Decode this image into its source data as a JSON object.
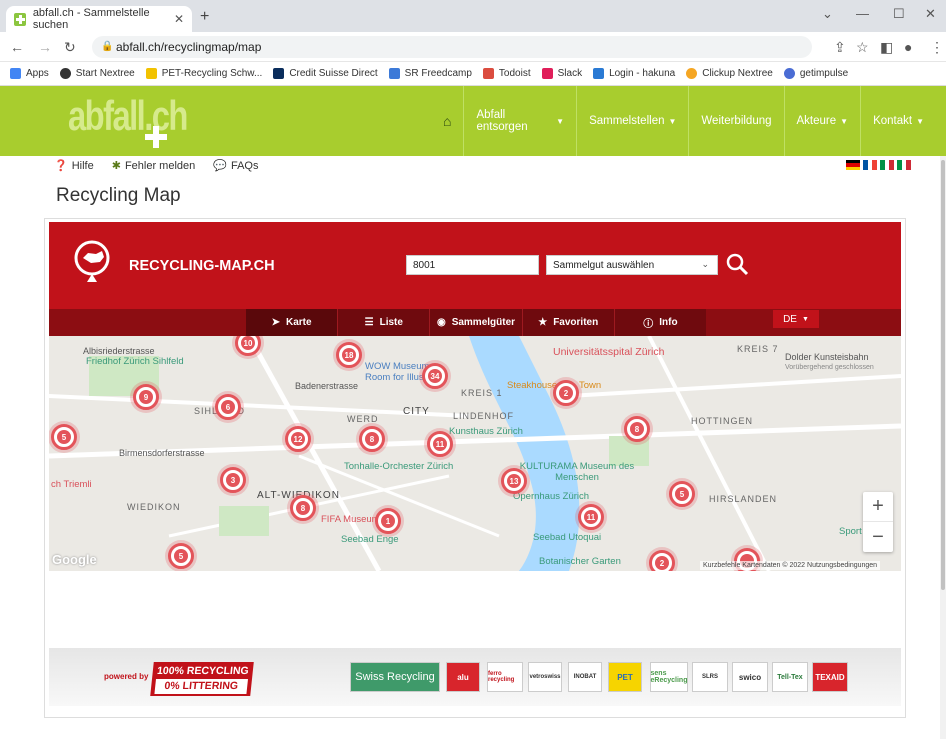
{
  "browser": {
    "tab_title": "abfall.ch - Sammelstelle suchen",
    "url": "abfall.ch/recyclingmap/map",
    "bookmarks": [
      "Apps",
      "Start Nextree",
      "PET-Recycling Schw...",
      "Credit Suisse Direct",
      "SR Freedcamp",
      "Todoist",
      "Slack",
      "Login - hakuna",
      "Clickup Nextree",
      "getimpulse"
    ]
  },
  "site": {
    "logo_text": "abfall.ch",
    "nav": [
      {
        "label": "Abfall entsorgen",
        "caret": true
      },
      {
        "label": "Sammelstellen",
        "caret": true
      },
      {
        "label": "Weiterbildung",
        "caret": false
      },
      {
        "label": "Akteure",
        "caret": true
      },
      {
        "label": "Kontakt",
        "caret": true
      }
    ],
    "sublinks": [
      "Hilfe",
      "Fehler melden",
      "FAQs"
    ],
    "page_title": "Recycling Map"
  },
  "recyclingmap": {
    "title": "RECYCLING-MAP.CH",
    "zip_value": "8001",
    "category_placeholder": "Sammelgut auswählen",
    "tabs": [
      "Karte",
      "Liste",
      "Sammelgüter",
      "Favoriten",
      "Info"
    ],
    "language": "DE"
  },
  "map": {
    "labels": [
      "Albisriederstrasse",
      "Friedhof Zürich Sihlfeld",
      "Badenerstrasse",
      "SIHLFELD",
      "Birmensdorferstrasse",
      "ch Triemli",
      "WIEDIKON",
      "ALT-WIEDIKON",
      "WERD",
      "CITY",
      "LINDENHOF",
      "KREIS 1",
      "HOTTINGEN",
      "HIRSLANDEN",
      "KREIS 7",
      "Universitätsspital Zürich",
      "WOW Museum Room for Illusions",
      "Steakhouse",
      "Town",
      "Kunsthaus Zürich",
      "KULTURAMA Museum des Menschen",
      "Tonhalle-Orchester Zürich",
      "Opernhaus Zürich",
      "FIFA Museum",
      "Seebad Enge",
      "Seebad Utoquai",
      "Botanischer Garten",
      "Dolder Kunsteisbahn",
      "Vorübergehend geschlossen",
      "Sport"
    ],
    "markers": [
      "10",
      "18",
      "34",
      "9",
      "6",
      "2",
      "5",
      "8",
      "12",
      "8",
      "11",
      "6",
      "3",
      "13",
      "5",
      "8",
      "1",
      "11",
      "5",
      "2",
      ""
    ],
    "attribution": "Kurzbefehle  Kartendaten © 2022  Nutzungsbedingungen",
    "google": "Google"
  },
  "footer": {
    "powered_by": "powered by",
    "badge_line1": "100% RECYCLING",
    "badge_line2": "0% LITTERING",
    "partners": [
      "Swiss Recycling",
      "alu",
      "ferro recycling",
      "vetroswiss",
      "INOBAT",
      "PET",
      "sens eRecycling",
      "SLRS",
      "swico",
      "Tell-Tex",
      "TEXAID"
    ]
  },
  "colors": {
    "brand_green": "#a8cd2e",
    "rm_red": "#c1121a",
    "marker_red": "#e3545a"
  }
}
